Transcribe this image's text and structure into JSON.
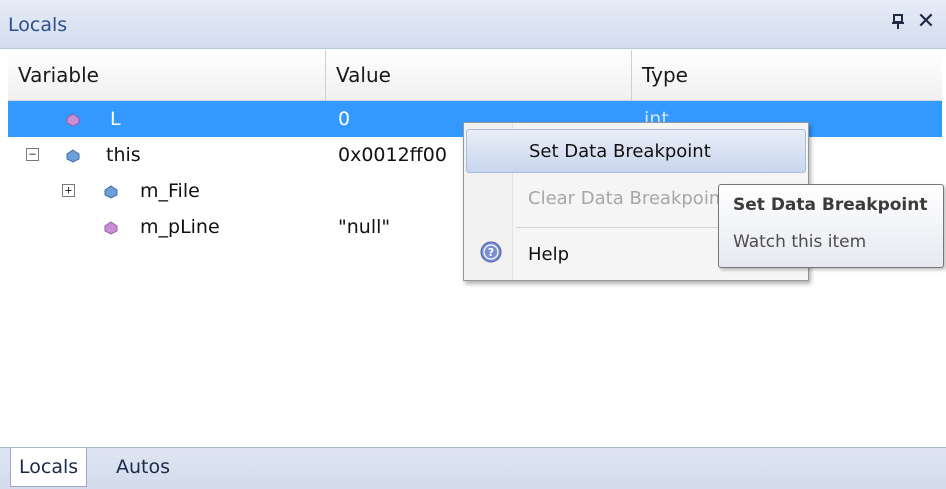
{
  "window": {
    "title": "Locals"
  },
  "columns": {
    "variable": "Variable",
    "value": "Value",
    "type": "Type"
  },
  "rows": [
    {
      "name": "L",
      "value": "0",
      "type": "int",
      "selected": true
    },
    {
      "name": "this",
      "value": "0x0012ff00",
      "type": "",
      "expander": "−"
    },
    {
      "name": "m_File",
      "value": "",
      "type": "",
      "expander": "+"
    },
    {
      "name": "m_pLine",
      "value": "\"null\"",
      "type": ""
    }
  ],
  "icons": {
    "pin": "pin-icon",
    "close": "close-icon",
    "help": "help-icon",
    "field": "field-icon"
  },
  "close_glyph": "✕",
  "context_menu": {
    "items": [
      {
        "label": "Set Data Breakpoint",
        "state": "highlighted"
      },
      {
        "label": "Clear Data Breakpoint",
        "state": "disabled"
      },
      {
        "label": "Help",
        "state": "normal"
      }
    ]
  },
  "tooltip": {
    "title": "Set Data Breakpoint",
    "description": "Watch this item"
  },
  "tabs": [
    {
      "label": "Locals",
      "active": true
    },
    {
      "label": "Autos",
      "active": false
    }
  ],
  "colors": {
    "selection": "#3399ff",
    "title_text": "#2d4f8a",
    "icon_purple": "#b56fb4",
    "icon_blue": "#4f86c6"
  }
}
